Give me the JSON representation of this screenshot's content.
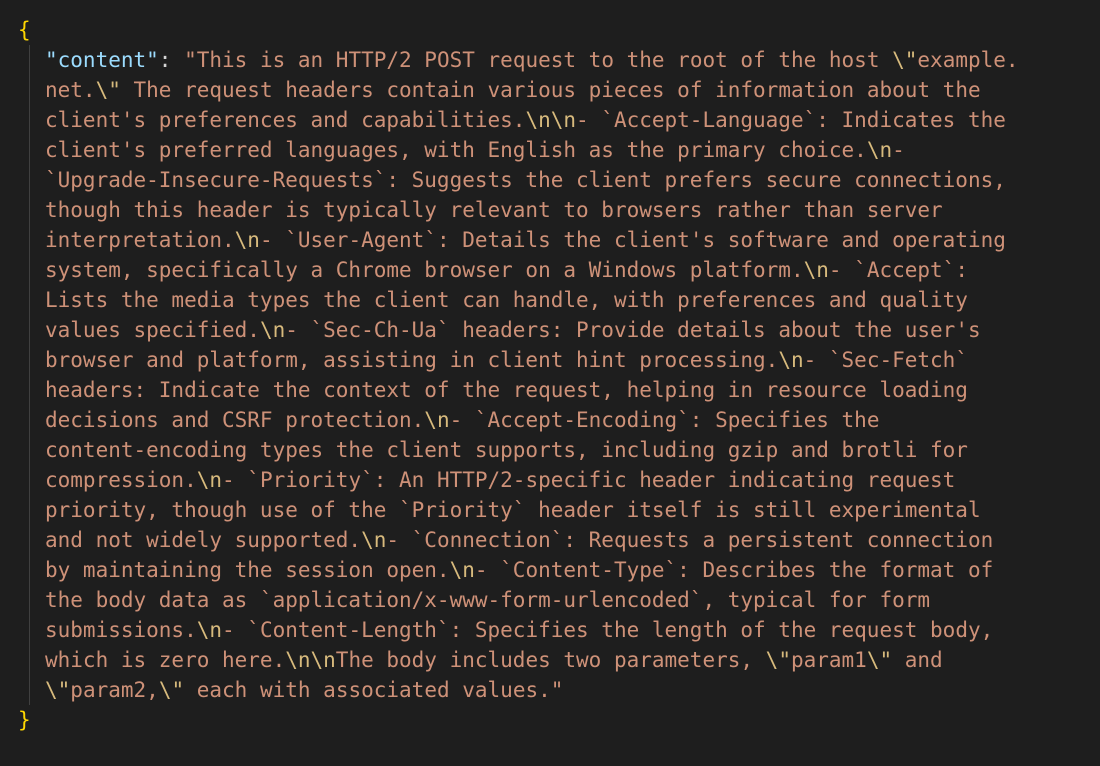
{
  "editor": {
    "open_brace": "{",
    "close_brace": "}",
    "key": "\"content\"",
    "colon": ": ",
    "lines": [
      [
        {
          "t": "s",
          "v": "\"This is an HTTP/2 POST request to the root of the host "
        },
        {
          "t": "e",
          "v": "\\\""
        },
        {
          "t": "s",
          "v": "example."
        }
      ],
      [
        {
          "t": "s",
          "v": "net."
        },
        {
          "t": "e",
          "v": "\\\""
        },
        {
          "t": "s",
          "v": " The request headers contain various pieces of information about the"
        }
      ],
      [
        {
          "t": "s",
          "v": "client's preferences and capabilities."
        },
        {
          "t": "e",
          "v": "\\n\\n"
        },
        {
          "t": "s",
          "v": "- `Accept-Language`: Indicates the"
        }
      ],
      [
        {
          "t": "s",
          "v": "client's preferred languages, with English as the primary choice."
        },
        {
          "t": "e",
          "v": "\\n"
        },
        {
          "t": "s",
          "v": "-"
        }
      ],
      [
        {
          "t": "s",
          "v": "`Upgrade-Insecure-Requests`: Suggests the client prefers secure connections,"
        }
      ],
      [
        {
          "t": "s",
          "v": "though this header is typically relevant to browsers rather than server"
        }
      ],
      [
        {
          "t": "s",
          "v": "interpretation."
        },
        {
          "t": "e",
          "v": "\\n"
        },
        {
          "t": "s",
          "v": "- `User-Agent`: Details the client's software and operating"
        }
      ],
      [
        {
          "t": "s",
          "v": "system, specifically a Chrome browser on a Windows platform."
        },
        {
          "t": "e",
          "v": "\\n"
        },
        {
          "t": "s",
          "v": "- `Accept`:"
        }
      ],
      [
        {
          "t": "s",
          "v": "Lists the media types the client can handle, with preferences and quality"
        }
      ],
      [
        {
          "t": "s",
          "v": "values specified."
        },
        {
          "t": "e",
          "v": "\\n"
        },
        {
          "t": "s",
          "v": "- `Sec-Ch-Ua` headers: Provide details about the user's"
        }
      ],
      [
        {
          "t": "s",
          "v": "browser and platform, assisting in client hint processing."
        },
        {
          "t": "e",
          "v": "\\n"
        },
        {
          "t": "s",
          "v": "- `Sec-Fetch`"
        }
      ],
      [
        {
          "t": "s",
          "v": "headers: Indicate the context of the request, helping in resource loading"
        }
      ],
      [
        {
          "t": "s",
          "v": "decisions and CSRF protection."
        },
        {
          "t": "e",
          "v": "\\n"
        },
        {
          "t": "s",
          "v": "- `Accept-Encoding`: Specifies the"
        }
      ],
      [
        {
          "t": "s",
          "v": "content-encoding types the client supports, including gzip and brotli for"
        }
      ],
      [
        {
          "t": "s",
          "v": "compression."
        },
        {
          "t": "e",
          "v": "\\n"
        },
        {
          "t": "s",
          "v": "- `Priority`: An HTTP/2-specific header indicating request"
        }
      ],
      [
        {
          "t": "s",
          "v": "priority, though use of the `Priority` header itself is still experimental"
        }
      ],
      [
        {
          "t": "s",
          "v": "and not widely supported."
        },
        {
          "t": "e",
          "v": "\\n"
        },
        {
          "t": "s",
          "v": "- `Connection`: Requests a persistent connection"
        }
      ],
      [
        {
          "t": "s",
          "v": "by maintaining the session open."
        },
        {
          "t": "e",
          "v": "\\n"
        },
        {
          "t": "s",
          "v": "- `Content-Type`: Describes the format of"
        }
      ],
      [
        {
          "t": "s",
          "v": "the body data as `application/x-www-form-urlencoded`, typical for form"
        }
      ],
      [
        {
          "t": "s",
          "v": "submissions."
        },
        {
          "t": "e",
          "v": "\\n"
        },
        {
          "t": "s",
          "v": "- `Content-Length`: Specifies the length of the request body,"
        }
      ],
      [
        {
          "t": "s",
          "v": "which is zero here."
        },
        {
          "t": "e",
          "v": "\\n\\n"
        },
        {
          "t": "s",
          "v": "The body includes two parameters, "
        },
        {
          "t": "e",
          "v": "\\\""
        },
        {
          "t": "s",
          "v": "param1"
        },
        {
          "t": "e",
          "v": "\\\""
        },
        {
          "t": "s",
          "v": " and"
        }
      ],
      [
        {
          "t": "e",
          "v": "\\\""
        },
        {
          "t": "s",
          "v": "param2,"
        },
        {
          "t": "e",
          "v": "\\\""
        },
        {
          "t": "s",
          "v": " each with associated values.\""
        }
      ]
    ]
  },
  "colors": {
    "background": "#1e1e1e",
    "key": "#9cdcfe",
    "string": "#ce9178",
    "escape": "#d7ba7d",
    "brace": "#ffd700"
  }
}
